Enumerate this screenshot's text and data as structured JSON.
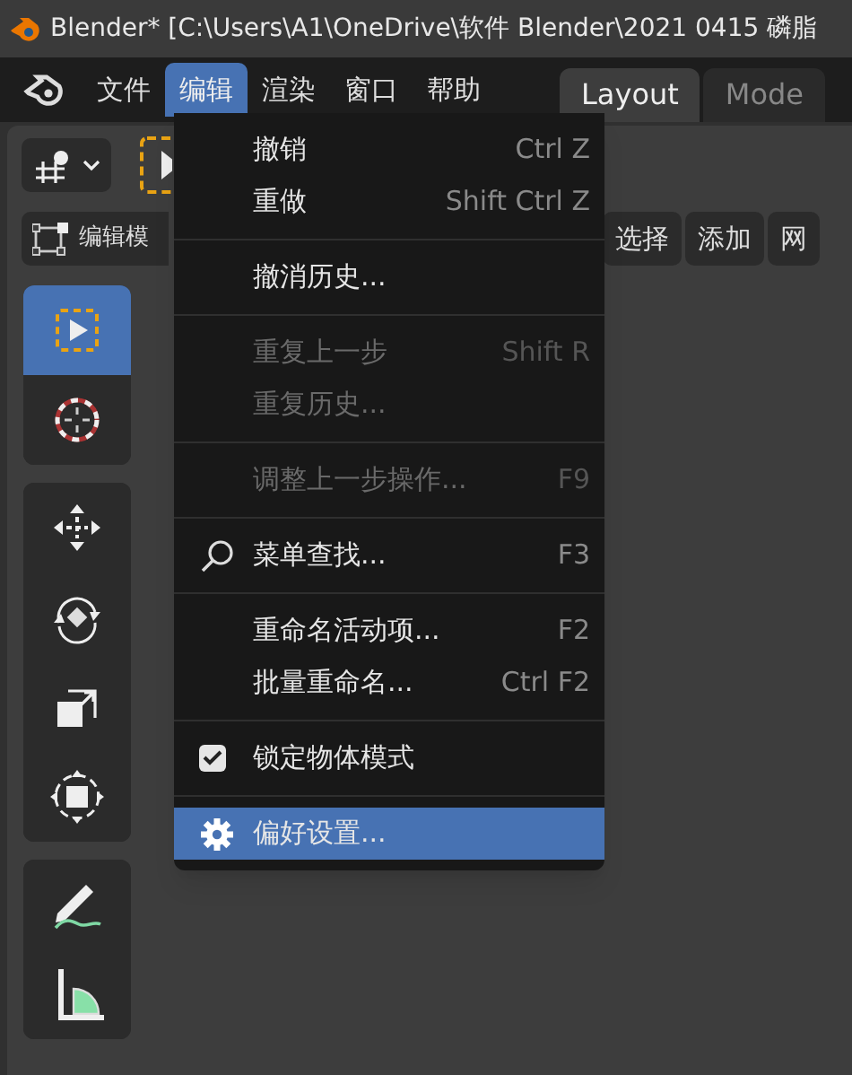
{
  "window": {
    "title": "Blender* [C:\\Users\\A1\\OneDrive\\软件 Blender\\2021 0415 磷脂"
  },
  "menubar": [
    {
      "label": "文件",
      "selected": false
    },
    {
      "label": "编辑",
      "selected": true
    },
    {
      "label": "渲染",
      "selected": false
    },
    {
      "label": "窗口",
      "selected": false
    },
    {
      "label": "帮助",
      "selected": false
    }
  ],
  "workspace_tabs": [
    {
      "label": "Layout",
      "selected": true
    },
    {
      "label": "Mode",
      "selected": false
    }
  ],
  "viewport_header": {
    "mode": "编辑模",
    "buttons": [
      "选择",
      "添加",
      "网"
    ]
  },
  "toolbar": [
    {
      "kind": "select",
      "selected": true
    },
    {
      "kind": "cursor",
      "selected": false
    },
    {
      "kind": "move",
      "selected": false
    },
    {
      "kind": "rotate",
      "selected": false
    },
    {
      "kind": "scale",
      "selected": false
    },
    {
      "kind": "transform",
      "selected": false
    },
    {
      "kind": "annotate",
      "selected": false
    },
    {
      "kind": "measure",
      "selected": false
    }
  ],
  "edit_menu": {
    "sections": [
      [
        {
          "kind": "plain",
          "label": "撤销",
          "shortcut": "Ctrl Z",
          "disabled": false,
          "selected": false
        },
        {
          "kind": "plain",
          "label": "重做",
          "shortcut": "Shift Ctrl Z",
          "disabled": false,
          "selected": false
        }
      ],
      [
        {
          "kind": "plain",
          "label": "撤消历史...",
          "disabled": false,
          "selected": false
        }
      ],
      [
        {
          "kind": "plain",
          "label": "重复上一步",
          "shortcut": "Shift R",
          "disabled": true,
          "selected": false
        },
        {
          "kind": "plain",
          "label": "重复历史...",
          "disabled": true,
          "selected": false
        }
      ],
      [
        {
          "kind": "plain",
          "label": "调整上一步操作...",
          "shortcut": "F9",
          "disabled": true,
          "selected": false
        }
      ],
      [
        {
          "kind": "search",
          "label": "菜单查找...",
          "shortcut": "F3",
          "disabled": false,
          "selected": false
        }
      ],
      [
        {
          "kind": "plain",
          "label": "重命名活动项...",
          "shortcut": "F2",
          "disabled": false,
          "selected": false
        },
        {
          "kind": "plain",
          "label": "批量重命名...",
          "shortcut": "Ctrl F2",
          "disabled": false,
          "selected": false
        }
      ],
      [
        {
          "kind": "checkbox",
          "label": "锁定物体模式",
          "checked": true,
          "disabled": false,
          "selected": false
        }
      ],
      [
        {
          "kind": "settings",
          "label": "偏好设置...",
          "disabled": false,
          "selected": true
        }
      ]
    ]
  }
}
